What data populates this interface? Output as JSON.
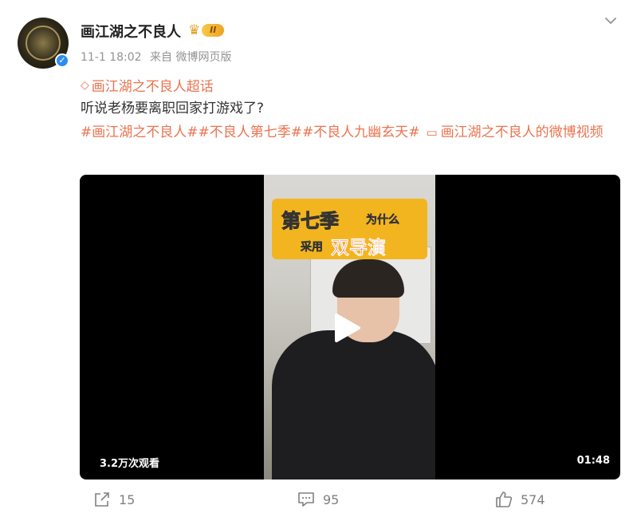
{
  "post": {
    "username": "画江湖之不良人",
    "level": "II",
    "timestamp": "11-1 18:02",
    "source": "来自 微博网页版",
    "supertopic": "画江湖之不良人超话",
    "text": "听说老杨要离职回家打游戏了?",
    "tags": [
      "#画江湖之不良人#",
      "#不良人第七季#",
      "#不良人九幽玄天#"
    ],
    "video_link": "画江湖之不良人的微博视频"
  },
  "video": {
    "banner_line1": "第七季",
    "banner_line1_small": "为什么",
    "banner_line2_small": "采用",
    "banner_line2": "双导演",
    "views": "3.2万次观看",
    "duration": "01:48"
  },
  "actions": {
    "shares": "15",
    "comments": "95",
    "likes": "574"
  },
  "colors": {
    "accent": "#eb7350",
    "verified": "#2d8cf0",
    "muted": "#939393"
  },
  "icons": {
    "verified": "✓",
    "supertopic": "◇",
    "video_link": "▭"
  }
}
